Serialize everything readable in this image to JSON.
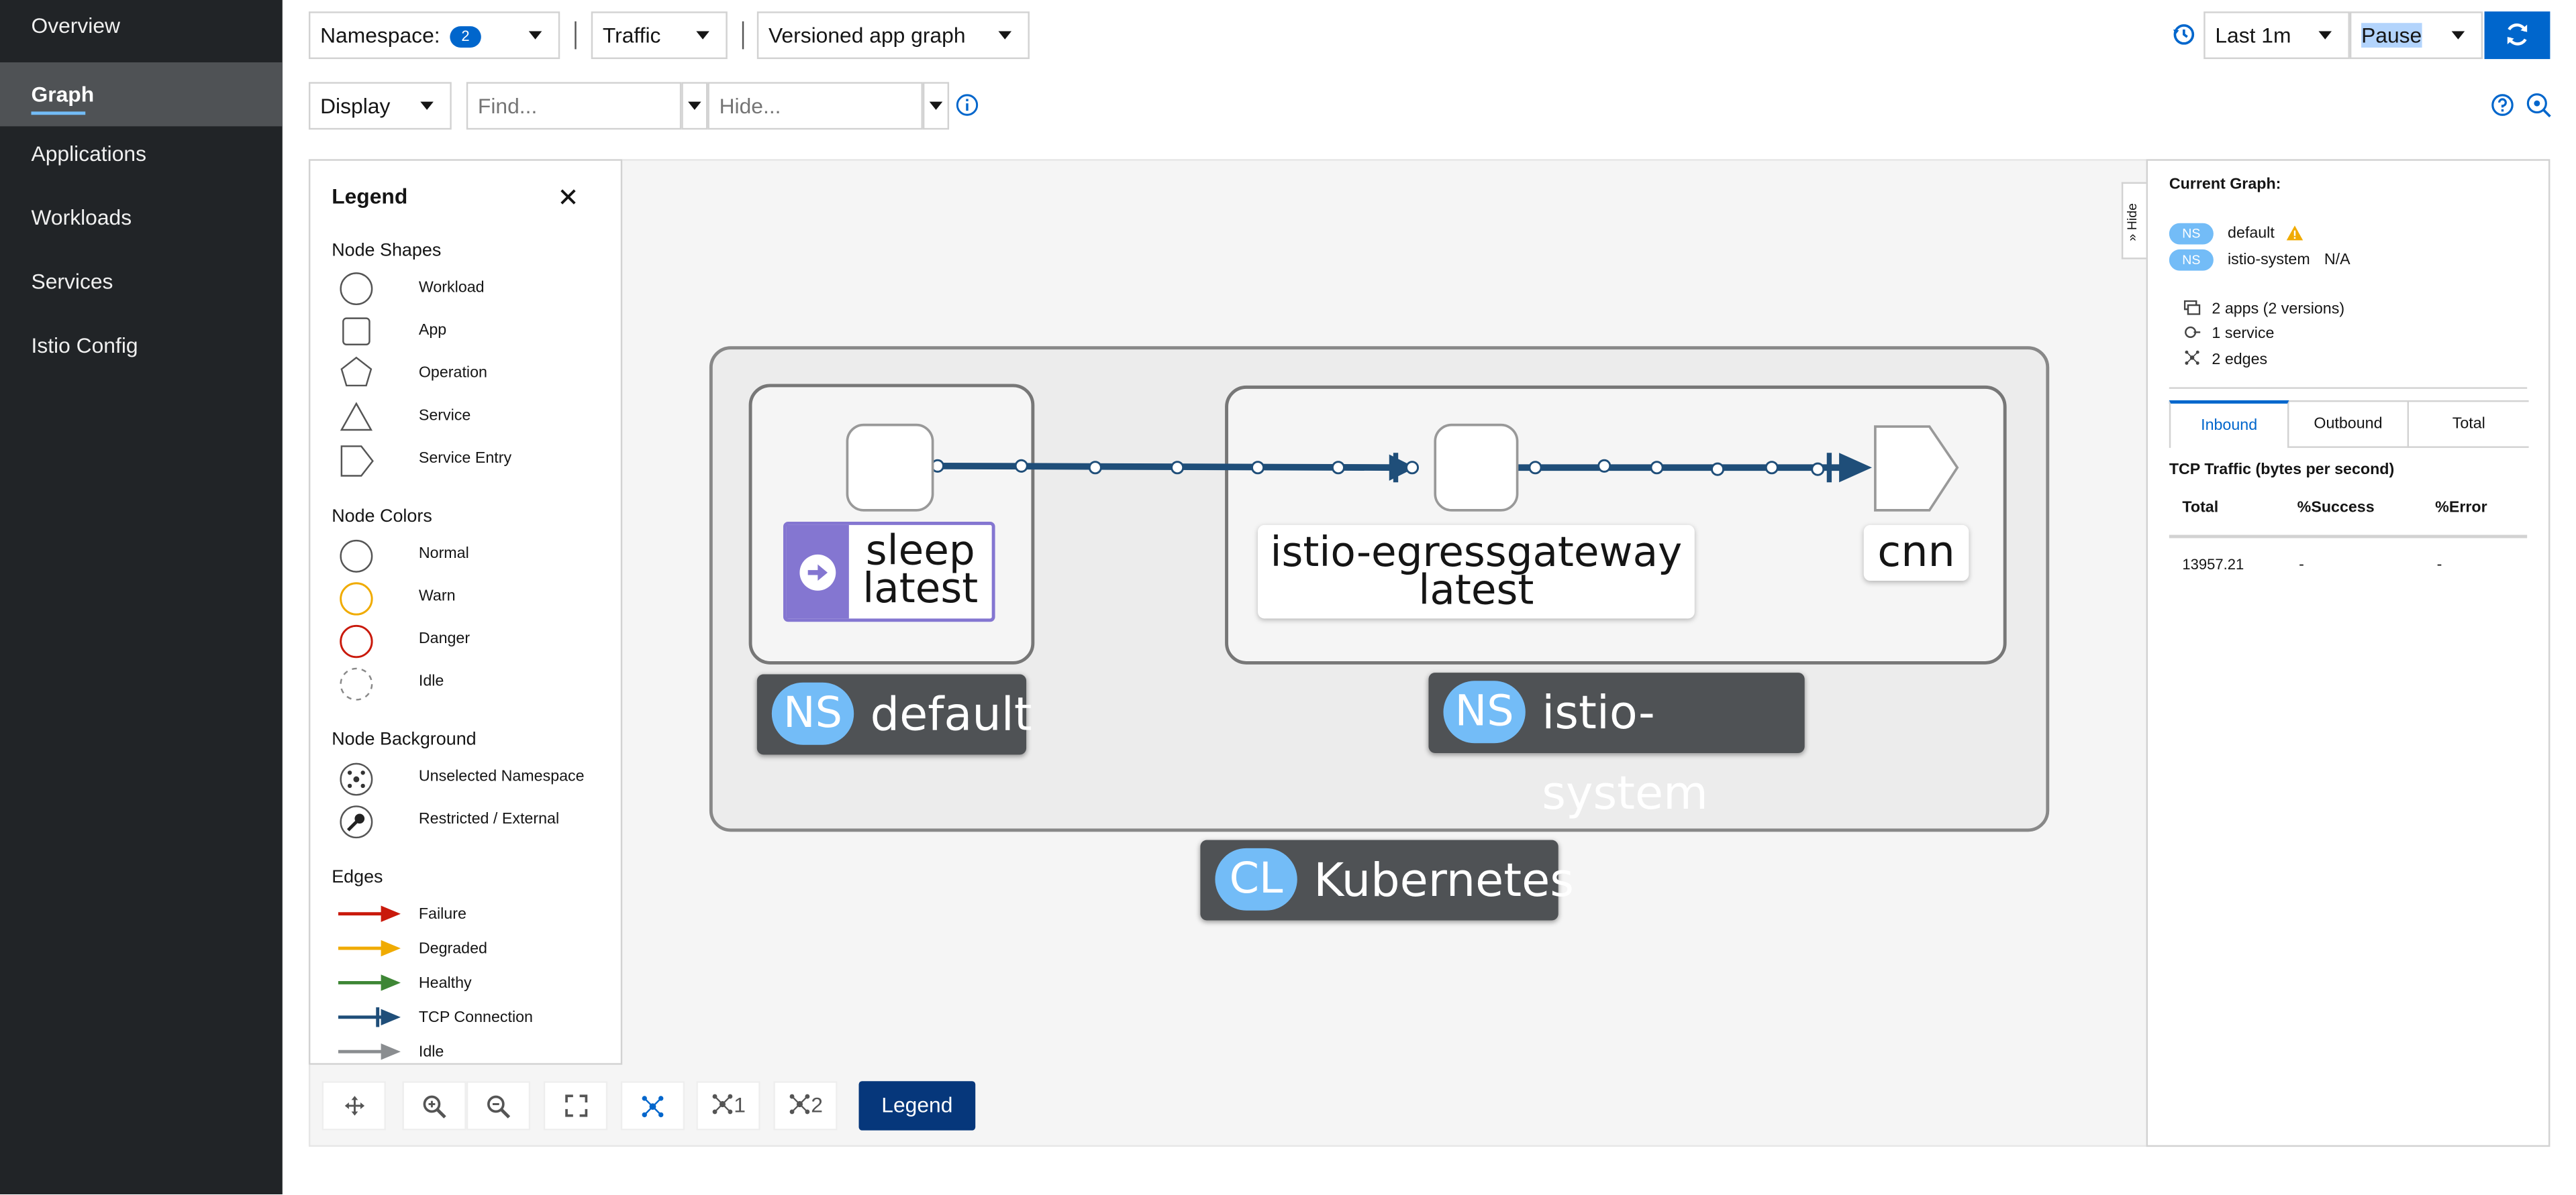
{
  "nav": {
    "items": [
      {
        "label": "Overview"
      },
      {
        "label": "Graph"
      },
      {
        "label": "Applications"
      },
      {
        "label": "Workloads"
      },
      {
        "label": "Services"
      },
      {
        "label": "Istio Config"
      }
    ]
  },
  "toolbar": {
    "namespace_label": "Namespace:",
    "namespace_count": "2",
    "traffic_label": "Traffic",
    "graph_type": "Versioned app graph",
    "time_range": "Last 1m",
    "refresh_interval": "Pause",
    "display_label": "Display",
    "find_placeholder": "Find...",
    "hide_placeholder": "Hide..."
  },
  "legend": {
    "title": "Legend",
    "node_shapes_heading": "Node Shapes",
    "node_shapes": [
      "Workload",
      "App",
      "Operation",
      "Service",
      "Service Entry"
    ],
    "node_colors_heading": "Node Colors",
    "node_colors": [
      "Normal",
      "Warn",
      "Danger",
      "Idle"
    ],
    "node_background_heading": "Node Background",
    "node_backgrounds": [
      "Unselected Namespace",
      "Restricted / External"
    ],
    "edges_heading": "Edges",
    "edges": [
      "Failure",
      "Degraded",
      "Healthy",
      "TCP Connection",
      "Idle"
    ],
    "colors": {
      "failure": "#c9190b",
      "degraded": "#f0ab00",
      "healthy": "#3e8635",
      "tcp": "#1f4e79",
      "idle": "#8a8d90"
    }
  },
  "graph": {
    "cluster_badge": "CL",
    "cluster_name": "Kubernetes",
    "ns_badge": "NS",
    "namespaces": [
      {
        "name": "default"
      },
      {
        "name": "istio-system"
      }
    ],
    "nodes": {
      "sleep_line1": "sleep",
      "sleep_line2": "latest",
      "egress_line1": "istio-egressgateway",
      "egress_line2": "latest",
      "cnn": "cnn"
    }
  },
  "bottom_toolbar": {
    "ns1_count": "1",
    "ns2_count": "2",
    "legend_button": "Legend"
  },
  "side_panel": {
    "hide_label": "Hide",
    "current_graph_label": "Current Graph:",
    "ns_badge": "NS",
    "ns1": "default",
    "ns2": "istio-system",
    "ns2_status": "N/A",
    "apps": "2 apps (2 versions)",
    "services": "1 service",
    "edges": "2 edges",
    "tabs": [
      "Inbound",
      "Outbound",
      "Total"
    ],
    "traffic_title": "TCP Traffic (bytes per second)",
    "columns": [
      "Total",
      "%Success",
      "%Error"
    ],
    "row": [
      "13957.21",
      "-",
      "-"
    ]
  }
}
